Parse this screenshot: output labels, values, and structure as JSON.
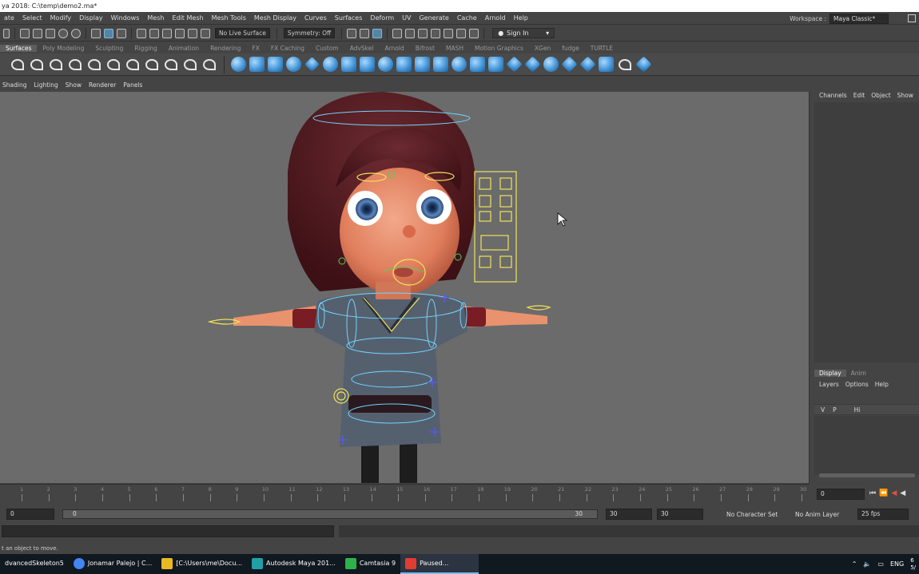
{
  "window": {
    "title": "ya 2018: C:\\temp\\demo2.ma*"
  },
  "menubar": {
    "items": [
      "ate",
      "Select",
      "Modify",
      "Display",
      "Windows",
      "Mesh",
      "Edit Mesh",
      "Mesh Tools",
      "Mesh Display",
      "Curves",
      "Surfaces",
      "Deform",
      "UV",
      "Generate",
      "Cache",
      "Arnold",
      "Help"
    ]
  },
  "workspace": {
    "label": "Workspace :",
    "value": "Maya Classic*"
  },
  "statusline": {
    "live_surface": "No Live Surface",
    "symmetry": "Symmetry: Off",
    "sign_in": "Sign In"
  },
  "shelf": {
    "tabs": [
      "Surfaces",
      "Poly Modeling",
      "Sculpting",
      "Rigging",
      "Animation",
      "Rendering",
      "FX",
      "FX Caching",
      "Custom",
      "AdvSkel",
      "Arnold",
      "Bifrost",
      "MASH",
      "Motion Graphics",
      "XGen",
      "fudge",
      "TURTLE"
    ],
    "active_tab": "Surfaces"
  },
  "panel_menu": {
    "items": [
      "Shading",
      "Lighting",
      "Show",
      "Renderer",
      "Panels"
    ]
  },
  "channel_box": {
    "menu": [
      "Channels",
      "Edit",
      "Object",
      "Show"
    ]
  },
  "layer_editor": {
    "tabs": [
      "Display",
      "Anim"
    ],
    "active_tab": "Display",
    "menu": [
      "Layers",
      "Options",
      "Help"
    ],
    "row": {
      "v": "V",
      "p": "P",
      "name": "Hi"
    }
  },
  "time_slider": {
    "labels": [
      "1",
      "2",
      "3",
      "4",
      "5",
      "6",
      "7",
      "8",
      "9",
      "10",
      "11",
      "12",
      "13",
      "14",
      "15",
      "16",
      "17",
      "18",
      "19",
      "20",
      "21",
      "22",
      "23",
      "24",
      "25",
      "26",
      "27",
      "28",
      "29",
      "30"
    ],
    "current_frame": "0"
  },
  "range_slider": {
    "start": "0",
    "range_start": "0",
    "range_end": "30",
    "end": "30",
    "end2": "30",
    "character_set": "No Character Set",
    "anim_layer": "No Anim Layer",
    "fps": "25 fps"
  },
  "help_line": {
    "text": "t an object to move."
  },
  "taskbar": {
    "items": [
      {
        "label": "dvancedSkeleton5",
        "color": "#2d2d2d",
        "active": false
      },
      {
        "label": "Jonamar Palejo | C...",
        "color": "#4285f4",
        "active": false
      },
      {
        "label": "[C:\\Users\\me\\Docu...",
        "color": "#e8b923",
        "active": false
      },
      {
        "label": "Autodesk Maya 201...",
        "color": "#21a0a8",
        "active": false
      },
      {
        "label": "Camtasia 9",
        "color": "#2db34a",
        "active": false
      },
      {
        "label": "Paused...",
        "color": "#e03c31",
        "active": true
      }
    ],
    "tray_lang": "ENG",
    "tray_time": "6",
    "tray_date": "5/"
  },
  "colors": {
    "accent": "#5285a6",
    "viewport_bg": "#6b6b6b",
    "control_yellow": "#f0e35a",
    "control_cyan": "#6fd6ff",
    "skin": "#e8926e",
    "hair": "#5a1f24"
  }
}
